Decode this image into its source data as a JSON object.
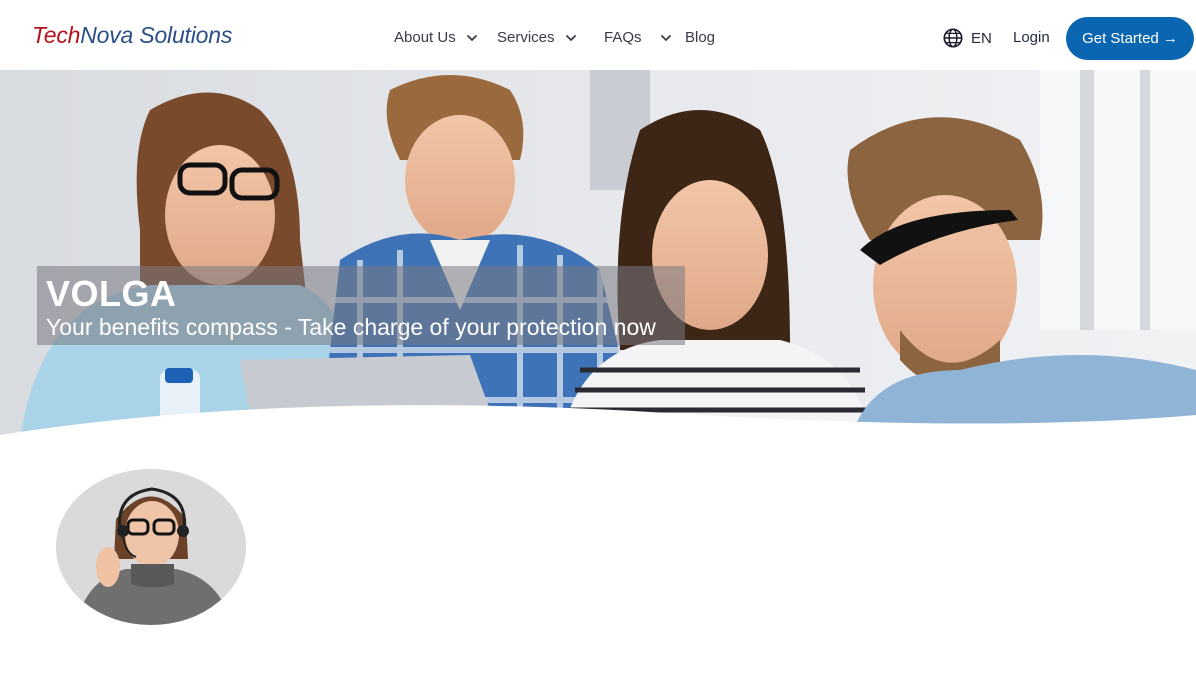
{
  "header": {
    "logo": {
      "part1": "Tech",
      "part2": "Nova Solutions"
    },
    "nav": [
      {
        "label": "About Us",
        "dropdown": true
      },
      {
        "label": "Services",
        "dropdown": true
      },
      {
        "label": "FAQs",
        "dropdown": true
      },
      {
        "label": "Blog",
        "dropdown": false
      }
    ],
    "language": "EN",
    "login_label": "Login",
    "cta_label": "Get Started →"
  },
  "hero": {
    "title": "VOLGA",
    "subtitle": "Your benefits compass - Take charge of your protection now"
  },
  "colors": {
    "brand_red": "#b3121b",
    "brand_blue": "#2b4f86",
    "cta_blue": "#0a66b0"
  },
  "icons": [
    "globe-icon",
    "chevron-down-icon"
  ]
}
